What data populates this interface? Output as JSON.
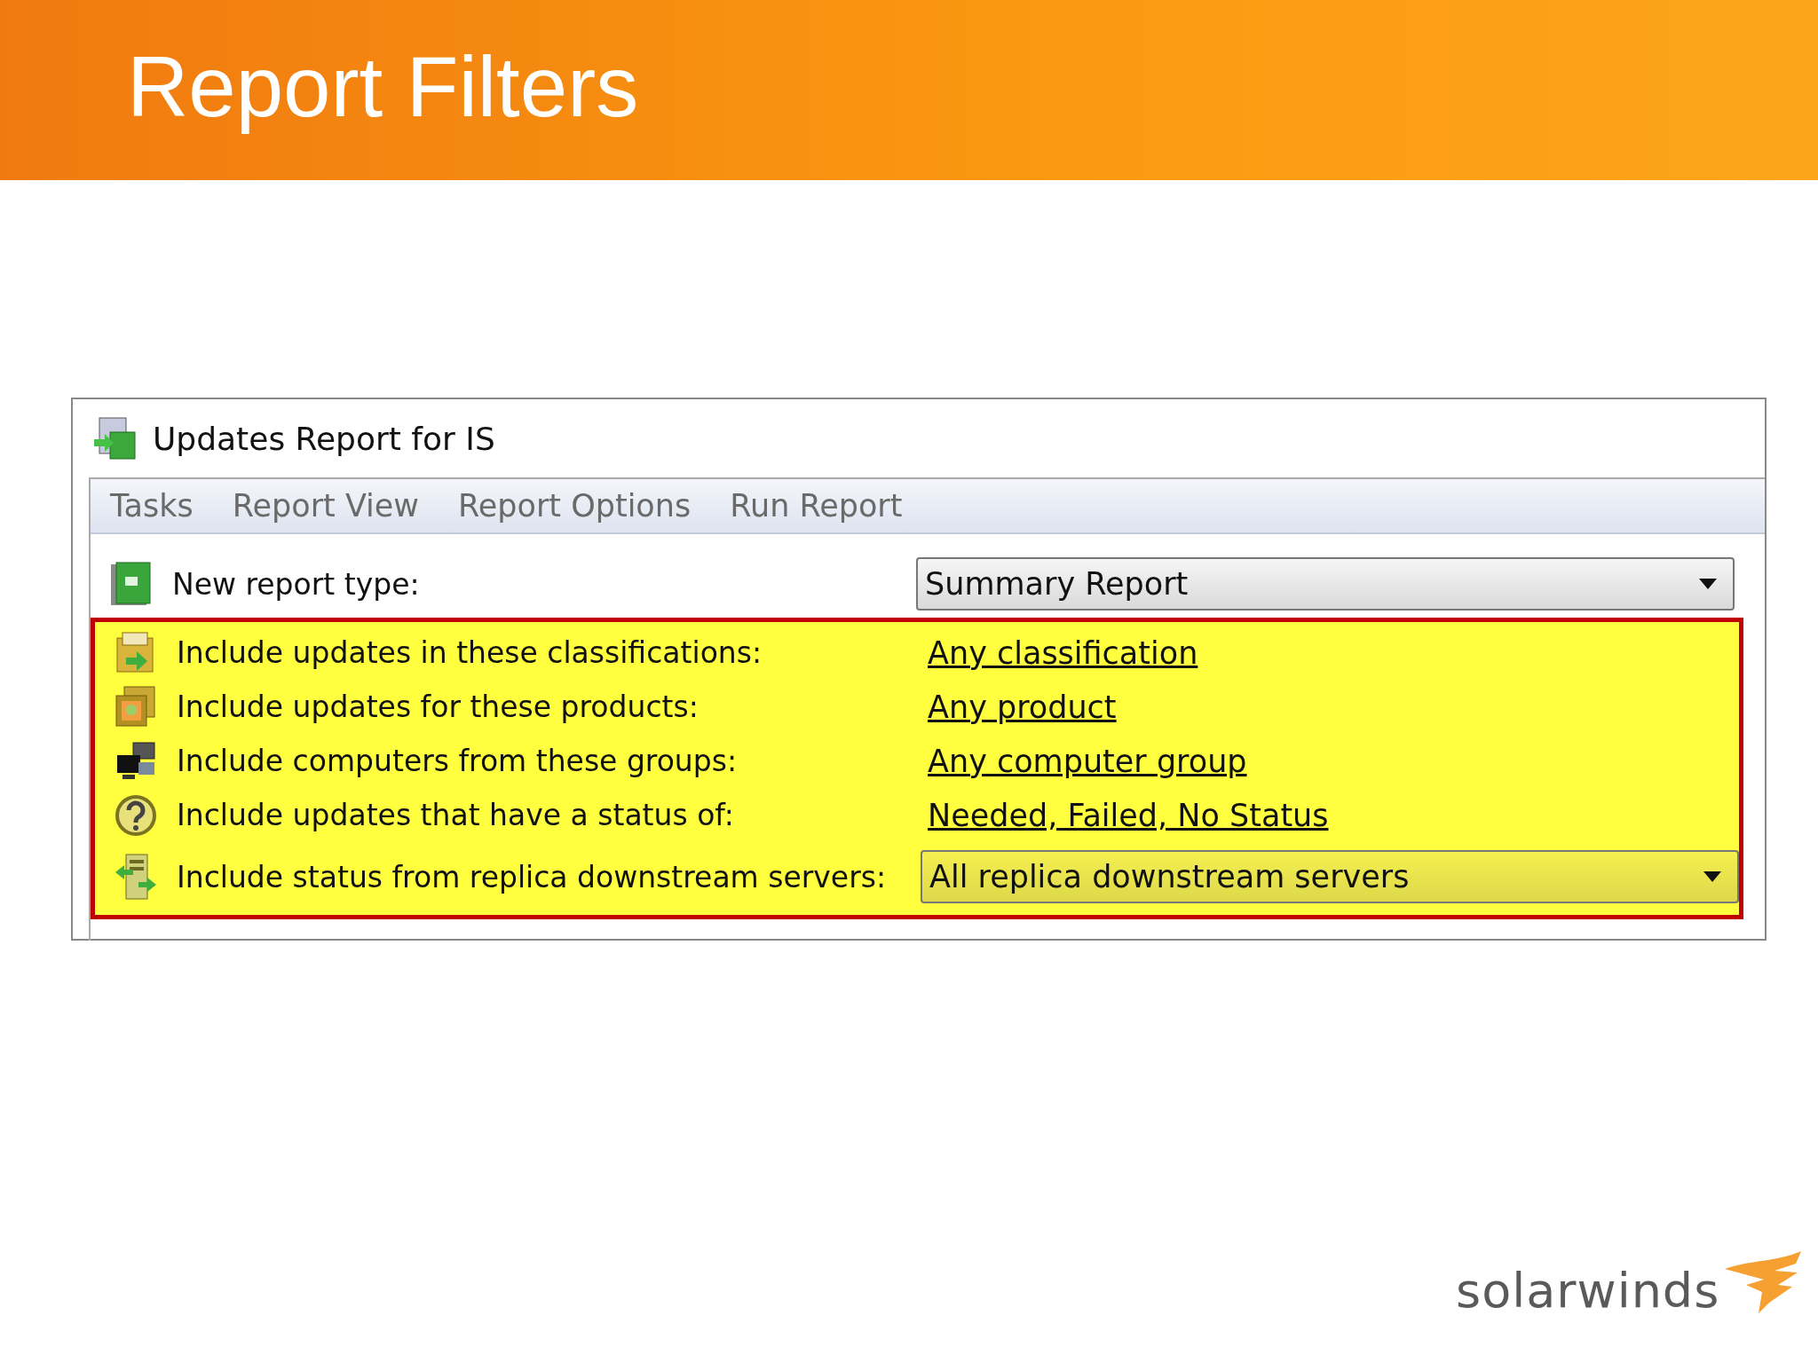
{
  "slide": {
    "title": "Report Filters"
  },
  "window": {
    "title": "Updates Report for IS"
  },
  "menu": [
    "Tasks",
    "Report View",
    "Report Options",
    "Run Report"
  ],
  "report_type": {
    "label": "New report type:",
    "value": "Summary Report"
  },
  "filters": {
    "highlighted": true,
    "rows": [
      {
        "kind": "link",
        "label": "Include updates in these classifications:",
        "value": "Any classification"
      },
      {
        "kind": "link",
        "label": "Include updates for these products:",
        "value": "Any product"
      },
      {
        "kind": "link",
        "label": "Include computers from these groups:",
        "value": "Any computer group"
      },
      {
        "kind": "link",
        "label": "Include updates that have a status of:",
        "value": "Needed, Failed, No Status"
      },
      {
        "kind": "dropdown",
        "label": "Include status from replica downstream servers:",
        "value": "All replica downstream servers"
      }
    ]
  },
  "logo": {
    "text": "solarwinds"
  }
}
